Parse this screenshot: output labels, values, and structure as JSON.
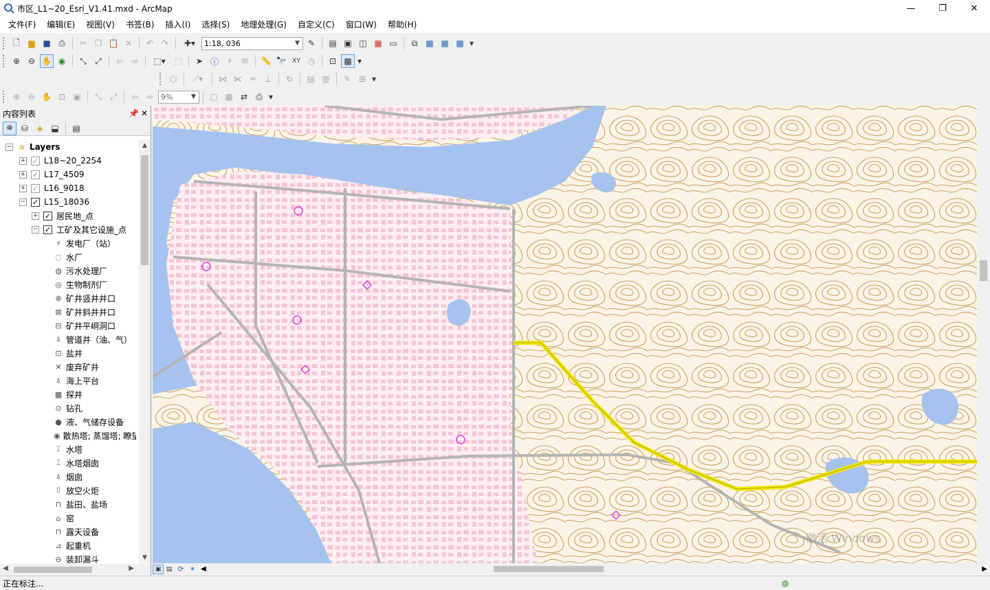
{
  "window": {
    "title": "市区_L1~20_Esri_V1.41.mxd - ArcMap",
    "minimize": "—",
    "maximize": "❐",
    "close": "✕"
  },
  "menu": [
    "文件(F)",
    "编辑(E)",
    "视图(V)",
    "书签(B)",
    "插入(I)",
    "选择(S)",
    "地理处理(G)",
    "自定义(C)",
    "窗口(W)",
    "帮助(H)"
  ],
  "toolbar": {
    "scale_value": "1:18, 036",
    "zoom_percent": "9%"
  },
  "toc": {
    "title": "内容列表",
    "root": "Layers",
    "layers": [
      {
        "label": "L18~20_2254",
        "checked": false
      },
      {
        "label": "L17_4509",
        "checked": false
      },
      {
        "label": "L16_9018",
        "checked": false
      },
      {
        "label": "L15_18036",
        "checked": true
      }
    ],
    "sublayers": [
      {
        "label": "居民地_点",
        "checked": true
      },
      {
        "label": "工矿及其它设施_点",
        "checked": true
      }
    ],
    "symbols": [
      {
        "label": "发电厂（站）",
        "icon": "power-plant-icon"
      },
      {
        "label": "水厂",
        "icon": "water-plant-icon"
      },
      {
        "label": "污水处理厂",
        "icon": "sewage-plant-icon"
      },
      {
        "label": "生物制剂厂",
        "icon": "bio-plant-icon"
      },
      {
        "label": "矿井竖井井口",
        "icon": "mine-shaft-icon"
      },
      {
        "label": "矿井斜井井口",
        "icon": "inclined-shaft-icon"
      },
      {
        "label": "矿井平峒洞口",
        "icon": "adit-icon"
      },
      {
        "label": "管道井（油、气）",
        "icon": "pipe-well-icon"
      },
      {
        "label": "盐井",
        "icon": "salt-well-icon"
      },
      {
        "label": "废弃矿井",
        "icon": "abandoned-mine-icon"
      },
      {
        "label": "海上平台",
        "icon": "offshore-platform-icon"
      },
      {
        "label": "探井",
        "icon": "exploration-well-icon"
      },
      {
        "label": "钻孔",
        "icon": "borehole-icon"
      },
      {
        "label": "液、气储存设备",
        "icon": "storage-tank-icon"
      },
      {
        "label": "散热塔; 蒸馏塔; 瞭望",
        "icon": "tower-icon"
      },
      {
        "label": "水塔",
        "icon": "water-tower-icon"
      },
      {
        "label": "水塔烟囱",
        "icon": "water-tower-chimney-icon"
      },
      {
        "label": "烟囱",
        "icon": "chimney-icon"
      },
      {
        "label": "放空火炬",
        "icon": "flare-icon"
      },
      {
        "label": "盐田、盐场",
        "icon": "salt-field-icon"
      },
      {
        "label": "窑",
        "icon": "kiln-icon"
      },
      {
        "label": "露天设备",
        "icon": "open-equipment-icon"
      },
      {
        "label": "起重机",
        "icon": "crane-icon"
      },
      {
        "label": "装卸漏斗",
        "icon": "hopper-icon"
      }
    ]
  },
  "status": {
    "text": "正在标注..."
  },
  "watermark": {
    "line1": "激活 Windows"
  },
  "colors": {
    "water": "#a6c3f0",
    "urban": "#f8d8e0",
    "contour": "#c8a060",
    "road": "#b4b4b4",
    "highlight": "#f0e800"
  }
}
